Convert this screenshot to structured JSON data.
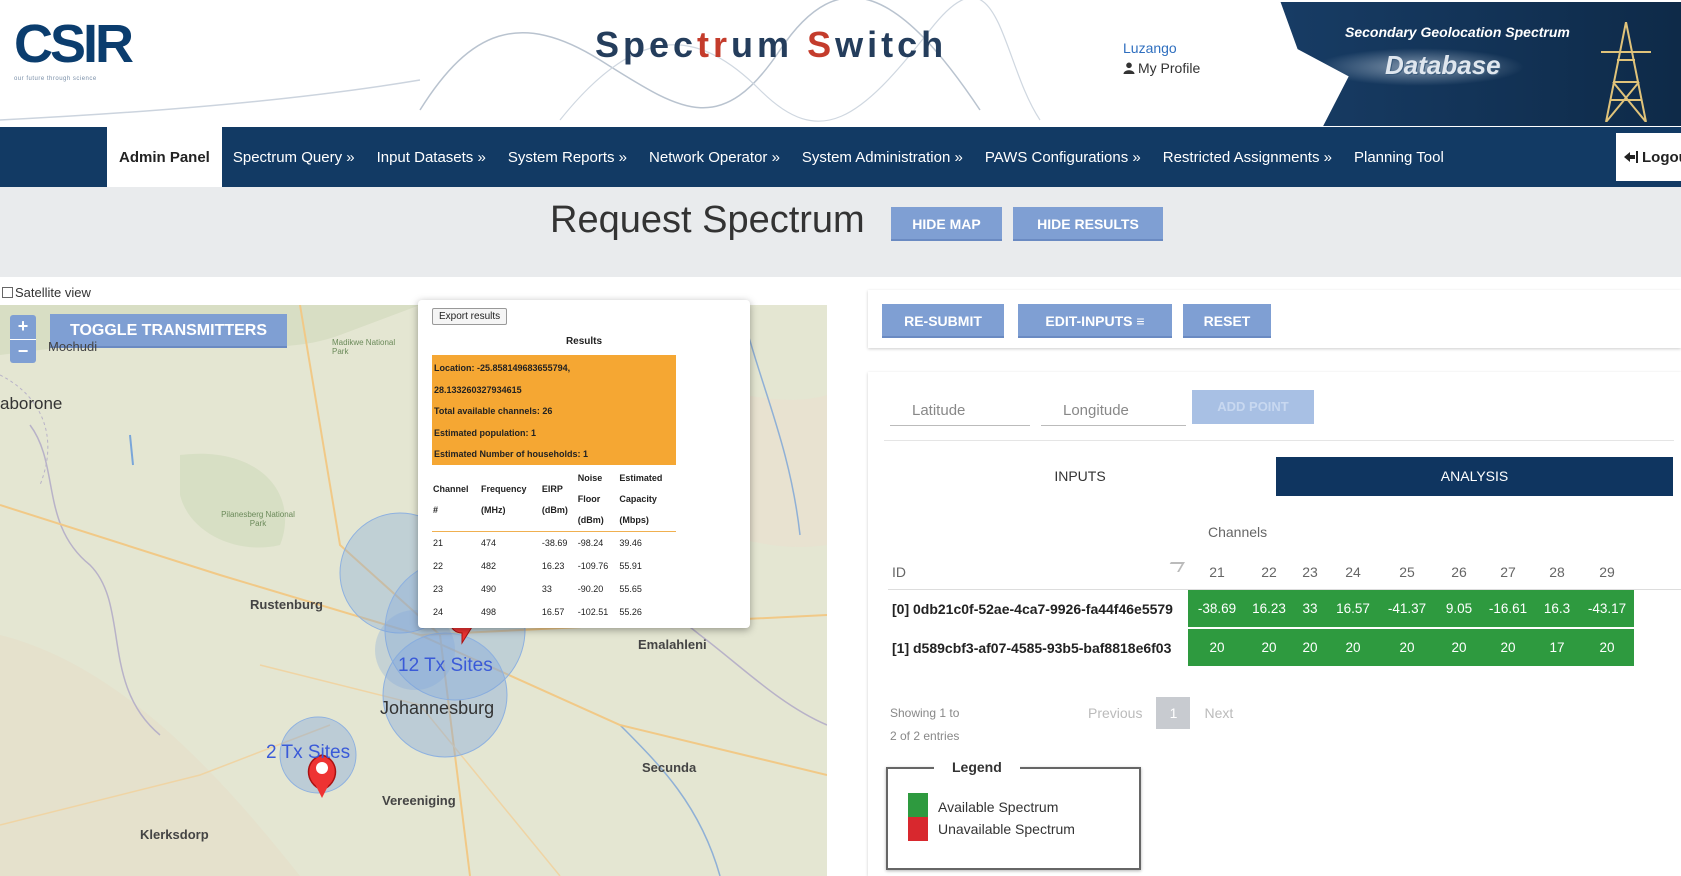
{
  "header": {
    "logo_text": "CSIR",
    "logo_tagline": "our future through science",
    "title_part1": "Spec",
    "title_accent": "tr",
    "title_part2": "um ",
    "title_accent2": "S",
    "title_part3": "witch",
    "username": "Luzango",
    "profile_label": "My Profile",
    "banner_line1": "Secondary Geolocation Spectrum",
    "banner_line2": "Database"
  },
  "nav": {
    "items": [
      "Admin Panel",
      "Spectrum Query »",
      "Input Datasets »",
      "System Reports »",
      "Network Operator »",
      "System Administration »",
      "PAWS Configurations »",
      "Restricted Assignments »",
      "Planning Tool"
    ],
    "logout": "Logout"
  },
  "titlebar": {
    "title": "Request Spectrum",
    "hide_map": "HIDE MAP",
    "hide_results": "HIDE RESULTS"
  },
  "map": {
    "satellite_label": "Satellite view",
    "zoom_in": "+",
    "zoom_out": "−",
    "toggle": "TOGGLE TRANSMITTERS",
    "places": {
      "gaborone": "aborone",
      "mochudi": "Mochudi",
      "rustenburg": "Rustenburg",
      "johannesburg": "Johannesburg",
      "emalahleni": "Emalahleni",
      "secunda": "Secunda",
      "vereeniging": "Vereeniging",
      "klerksdorp": "Klerksdorp",
      "madikwe": "Madikwe National Park",
      "pilanesberg": "Pilanesberg National Park"
    },
    "cluster1": "12 Tx Sites",
    "cluster2": "2 Tx Sites",
    "pin1": "0",
    "pin2": "1"
  },
  "popup": {
    "export": "Export results",
    "results": "Results",
    "summary": [
      "Location: -25.858149683655794,",
      "28.133260327934615",
      "Total available channels: 26",
      "Estimated population: 1",
      "Estimated Number of households: 1"
    ],
    "headers": {
      "ch1": "Channel",
      "ch2": "#",
      "fr1": "Frequency",
      "fr2": "(MHz)",
      "ei1": "EIRP",
      "ei2": "(dBm)",
      "nf1": "Noise",
      "nf2": "Floor",
      "nf3": "(dBm)",
      "ec1": "Estimated",
      "ec2": "Capacity",
      "ec3": "(Mbps)"
    },
    "rows": [
      [
        "21",
        "474",
        "-38.69",
        "-98.24",
        "39.46"
      ],
      [
        "22",
        "482",
        "16.23",
        "-109.76",
        "55.91"
      ],
      [
        "23",
        "490",
        "33",
        "-90.20",
        "55.65"
      ],
      [
        "24",
        "498",
        "16.57",
        "-102.51",
        "55.26"
      ]
    ]
  },
  "results": {
    "resubmit": "RE-SUBMIT",
    "edit_inputs": "EDIT-INPUTS ≡",
    "reset": "RESET",
    "latitude_ph": "Latitude",
    "longitude_ph": "Longitude",
    "add_point": "ADD POINT",
    "tab_inputs": "INPUTS",
    "tab_analysis": "ANALYSIS",
    "channels_label": "Channels",
    "id_header": "ID",
    "channels": [
      "21",
      "22",
      "23",
      "24",
      "25",
      "26",
      "27",
      "28",
      "29"
    ],
    "rows": [
      {
        "id": "[0] 0db21c0f-52ae-4ca7-9926-fa44f46e5579",
        "values": [
          "-38.69",
          "16.23",
          "33",
          "16.57",
          "-41.37",
          "9.05",
          "-16.61",
          "16.3",
          "-43.17"
        ]
      },
      {
        "id": "[1] d589cbf3-af07-4585-93b5-baf8818e6f03",
        "values": [
          "20",
          "20",
          "20",
          "20",
          "20",
          "20",
          "20",
          "17",
          "20"
        ]
      }
    ],
    "showing_line1": "Showing 1 to",
    "showing_line2": "2 of 2 entries",
    "previous": "Previous",
    "page": "1",
    "next": "Next",
    "legend_title": "Legend",
    "legend_available": "Available Spectrum",
    "legend_unavailable": "Unavailable Spectrum"
  },
  "colors": {
    "nav_bg": "#123a64",
    "button": "#7f9fd3",
    "available": "#2e9a3f",
    "unavailable": "#d8282e",
    "popup_highlight": "#f5a733",
    "analysis_tab": "#0f3560"
  }
}
